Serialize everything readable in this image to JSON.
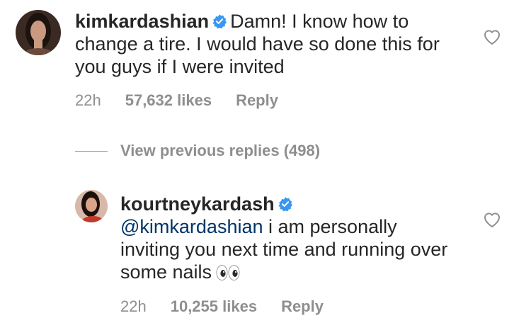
{
  "comment": {
    "username": "kimkardashian",
    "text": "Damn! I know how to change a tire. I would have so done this for you guys if I were invited",
    "time": "22h",
    "likes": "57,632 likes",
    "reply_label": "Reply"
  },
  "view_previous_replies": "View previous replies (498)",
  "reply": {
    "username": "kourtneykardash",
    "mention": "@kimkardashian",
    "text": "i am personally inviting you next time and running over some nails",
    "emoji": "eyes-emoji",
    "time": "22h",
    "likes": "10,255 likes",
    "reply_label": "Reply"
  },
  "icons": {
    "verified": "verified-badge-icon",
    "like": "heart-outline-icon"
  },
  "colors": {
    "text": "#262626",
    "secondary": "#8e8e8e",
    "mention": "#003569",
    "verified": "#3897f0"
  }
}
